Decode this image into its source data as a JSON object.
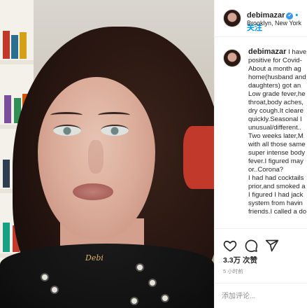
{
  "post": {
    "username": "debimazar",
    "verified_mark": "✔",
    "follow_label": "• 关注",
    "location": "Brooklyn, New York"
  },
  "caption": {
    "username": "debimazar",
    "lines": [
      "I have",
      "positive for Covid-",
      "About a month ag",
      "home(husband and",
      "daughters) got an",
      "Low grade fever,he",
      "throat,body aches,",
      "dry cough.It cleare",
      "quickly.Seasonal I",
      "unusual/different..",
      "Two weeks later,M",
      "with all those same",
      "super intense body",
      "fever.I figured may",
      "or..Corona?",
      "I had had cocktails",
      "prior,and smoked a",
      "I figured I had jack",
      "system from havin",
      "friends.I called a do"
    ]
  },
  "actions": {
    "like_icon": "heart-icon",
    "comment_icon": "comment-icon",
    "share_icon": "paper-plane-icon"
  },
  "likes": "3.3万 次赞",
  "timestamp": "5 小时前",
  "comment_input": {
    "placeholder": "添加评论...",
    "value": ""
  },
  "photo": {
    "necklace_text": "Debi"
  }
}
